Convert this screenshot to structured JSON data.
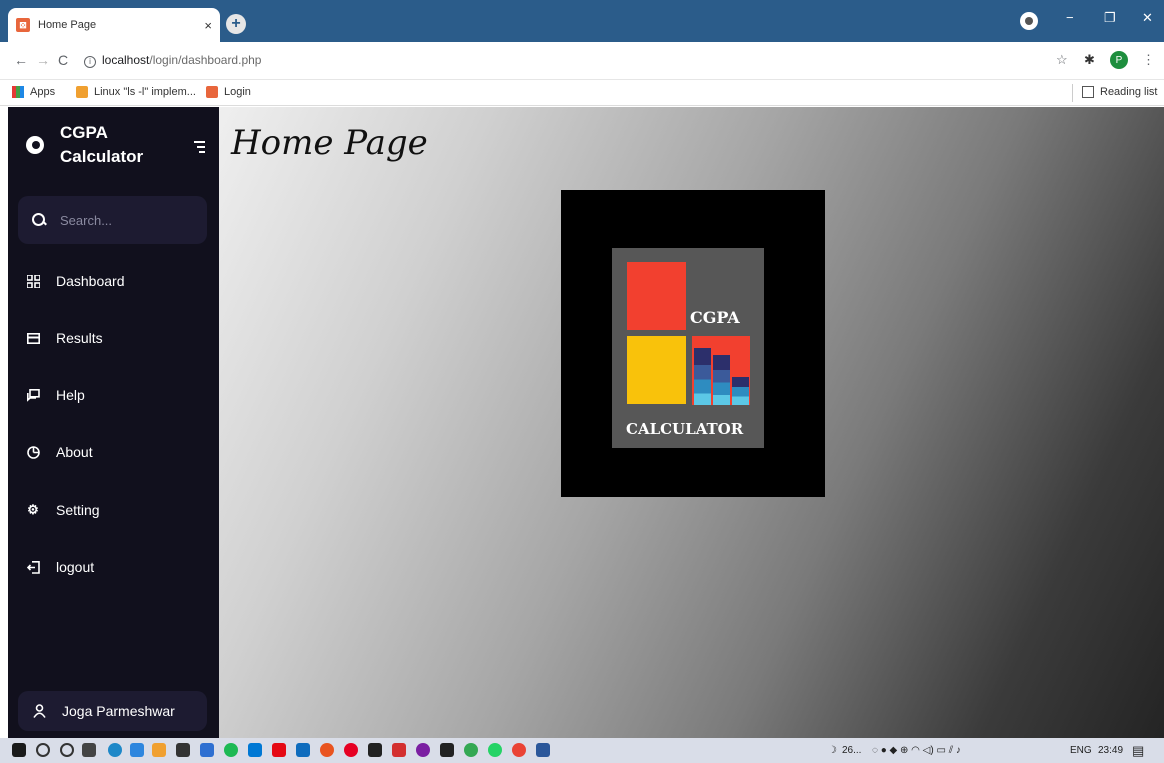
{
  "browser": {
    "tab_title": "Home Page",
    "tab_close": "×",
    "new_tab": "+",
    "url_host": "localhost",
    "url_path": "/login/dashboard.php",
    "profile_initial": "P",
    "window_controls": {
      "minimize": "−",
      "restore": "❐",
      "close": "✕"
    }
  },
  "bookmarks": {
    "apps": "Apps",
    "linux": "Linux \"ls -l\" implem...",
    "login": "Login",
    "reading_list": "Reading list"
  },
  "sidebar": {
    "brand_line1": "CGPA",
    "brand_line2": "Calculator",
    "search_placeholder": "Search...",
    "items": [
      {
        "label": "Dashboard",
        "icon": "grid-icon"
      },
      {
        "label": "Results",
        "icon": "card-icon"
      },
      {
        "label": "Help",
        "icon": "chat-icon"
      },
      {
        "label": "About",
        "icon": "pie-icon"
      },
      {
        "label": "Setting",
        "icon": "gear-icon"
      },
      {
        "label": "logout",
        "icon": "logout-icon"
      }
    ],
    "profile_name": "Joga Parmeshwar"
  },
  "main": {
    "title": "Home Page",
    "logo_text_top": "CGPA",
    "logo_text_bottom": "CALCULATOR"
  },
  "taskbar": {
    "weather": "26...",
    "language": "ENG",
    "time": "23:49"
  },
  "colors": {
    "sidebar_bg": "#11101d",
    "sidebar_field_bg": "#1d1b31",
    "tabbar_bg": "#2b5c8a",
    "logo_red": "#f2402f",
    "logo_yellow": "#f9c20b"
  }
}
